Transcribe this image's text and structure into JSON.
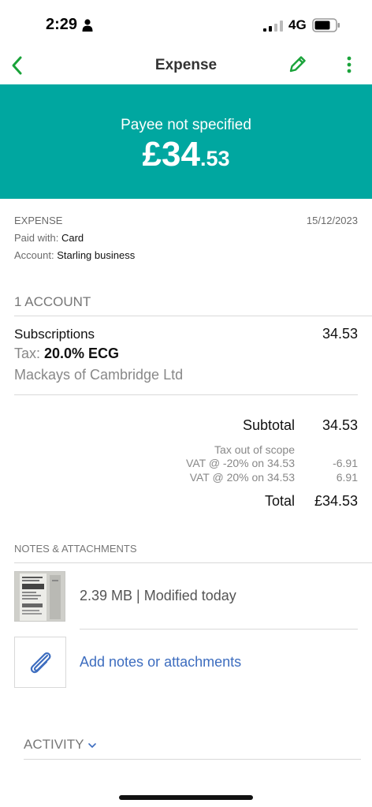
{
  "status_bar": {
    "time": "2:29",
    "network": "4G"
  },
  "nav": {
    "title": "Expense",
    "back_icon": "chevron-left-icon",
    "edit_icon": "pencil-icon",
    "more_icon": "more-vertical-icon",
    "accent_color": "#1aa33a"
  },
  "hero": {
    "payee": "Payee not specified",
    "amount_main": "£34",
    "amount_cents": ".53",
    "background_color": "#00a7a0"
  },
  "meta": {
    "type": "EXPENSE",
    "date": "15/12/2023",
    "paid_with_label": "Paid with: ",
    "paid_with_value": "Card",
    "account_label": "Account: ",
    "account_value": "Starling business"
  },
  "accounts_section": {
    "heading": "1 ACCOUNT",
    "item": {
      "name": "Subscriptions",
      "amount": "34.53",
      "tax_label": "Tax: ",
      "tax_value": "20.0% ECG",
      "payee": "Mackays of Cambridge Ltd"
    }
  },
  "summary": {
    "subtotal_label": "Subtotal",
    "subtotal_value": "34.53",
    "tax_scope_label": "Tax out of scope",
    "vat_rows": [
      {
        "label": "VAT @ -20% on 34.53",
        "value": "-6.91"
      },
      {
        "label": "VAT @ 20% on 34.53",
        "value": "6.91"
      }
    ],
    "total_label": "Total",
    "total_value": "£34.53"
  },
  "notes": {
    "heading": "NOTES & ATTACHMENTS",
    "attachment_info": "2.39 MB | Modified today",
    "add_link": "Add notes or attachments",
    "add_icon": "paperclip-icon",
    "link_color": "#3d6dbf"
  },
  "activity": {
    "label": "ACTIVITY",
    "icon": "chevron-down-icon"
  }
}
